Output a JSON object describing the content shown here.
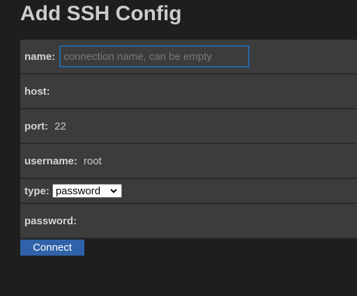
{
  "page": {
    "title": "Add SSH Config"
  },
  "form": {
    "name": {
      "label": "name:",
      "value": "",
      "placeholder": "connection name, can be empty"
    },
    "host": {
      "label": "host:",
      "value": ""
    },
    "port": {
      "label": "port:",
      "value": "22"
    },
    "username": {
      "label": "username:",
      "value": "root"
    },
    "type": {
      "label": "type:",
      "selected": "password",
      "icon": "chevron-down-icon"
    },
    "password": {
      "label": "password:",
      "value": ""
    }
  },
  "actions": {
    "connect_label": "Connect"
  },
  "colors": {
    "background": "#1e1e1e",
    "row_background": "#3c3c3c",
    "accent": "#2f62a8",
    "focus_border": "#2f6fb5"
  }
}
